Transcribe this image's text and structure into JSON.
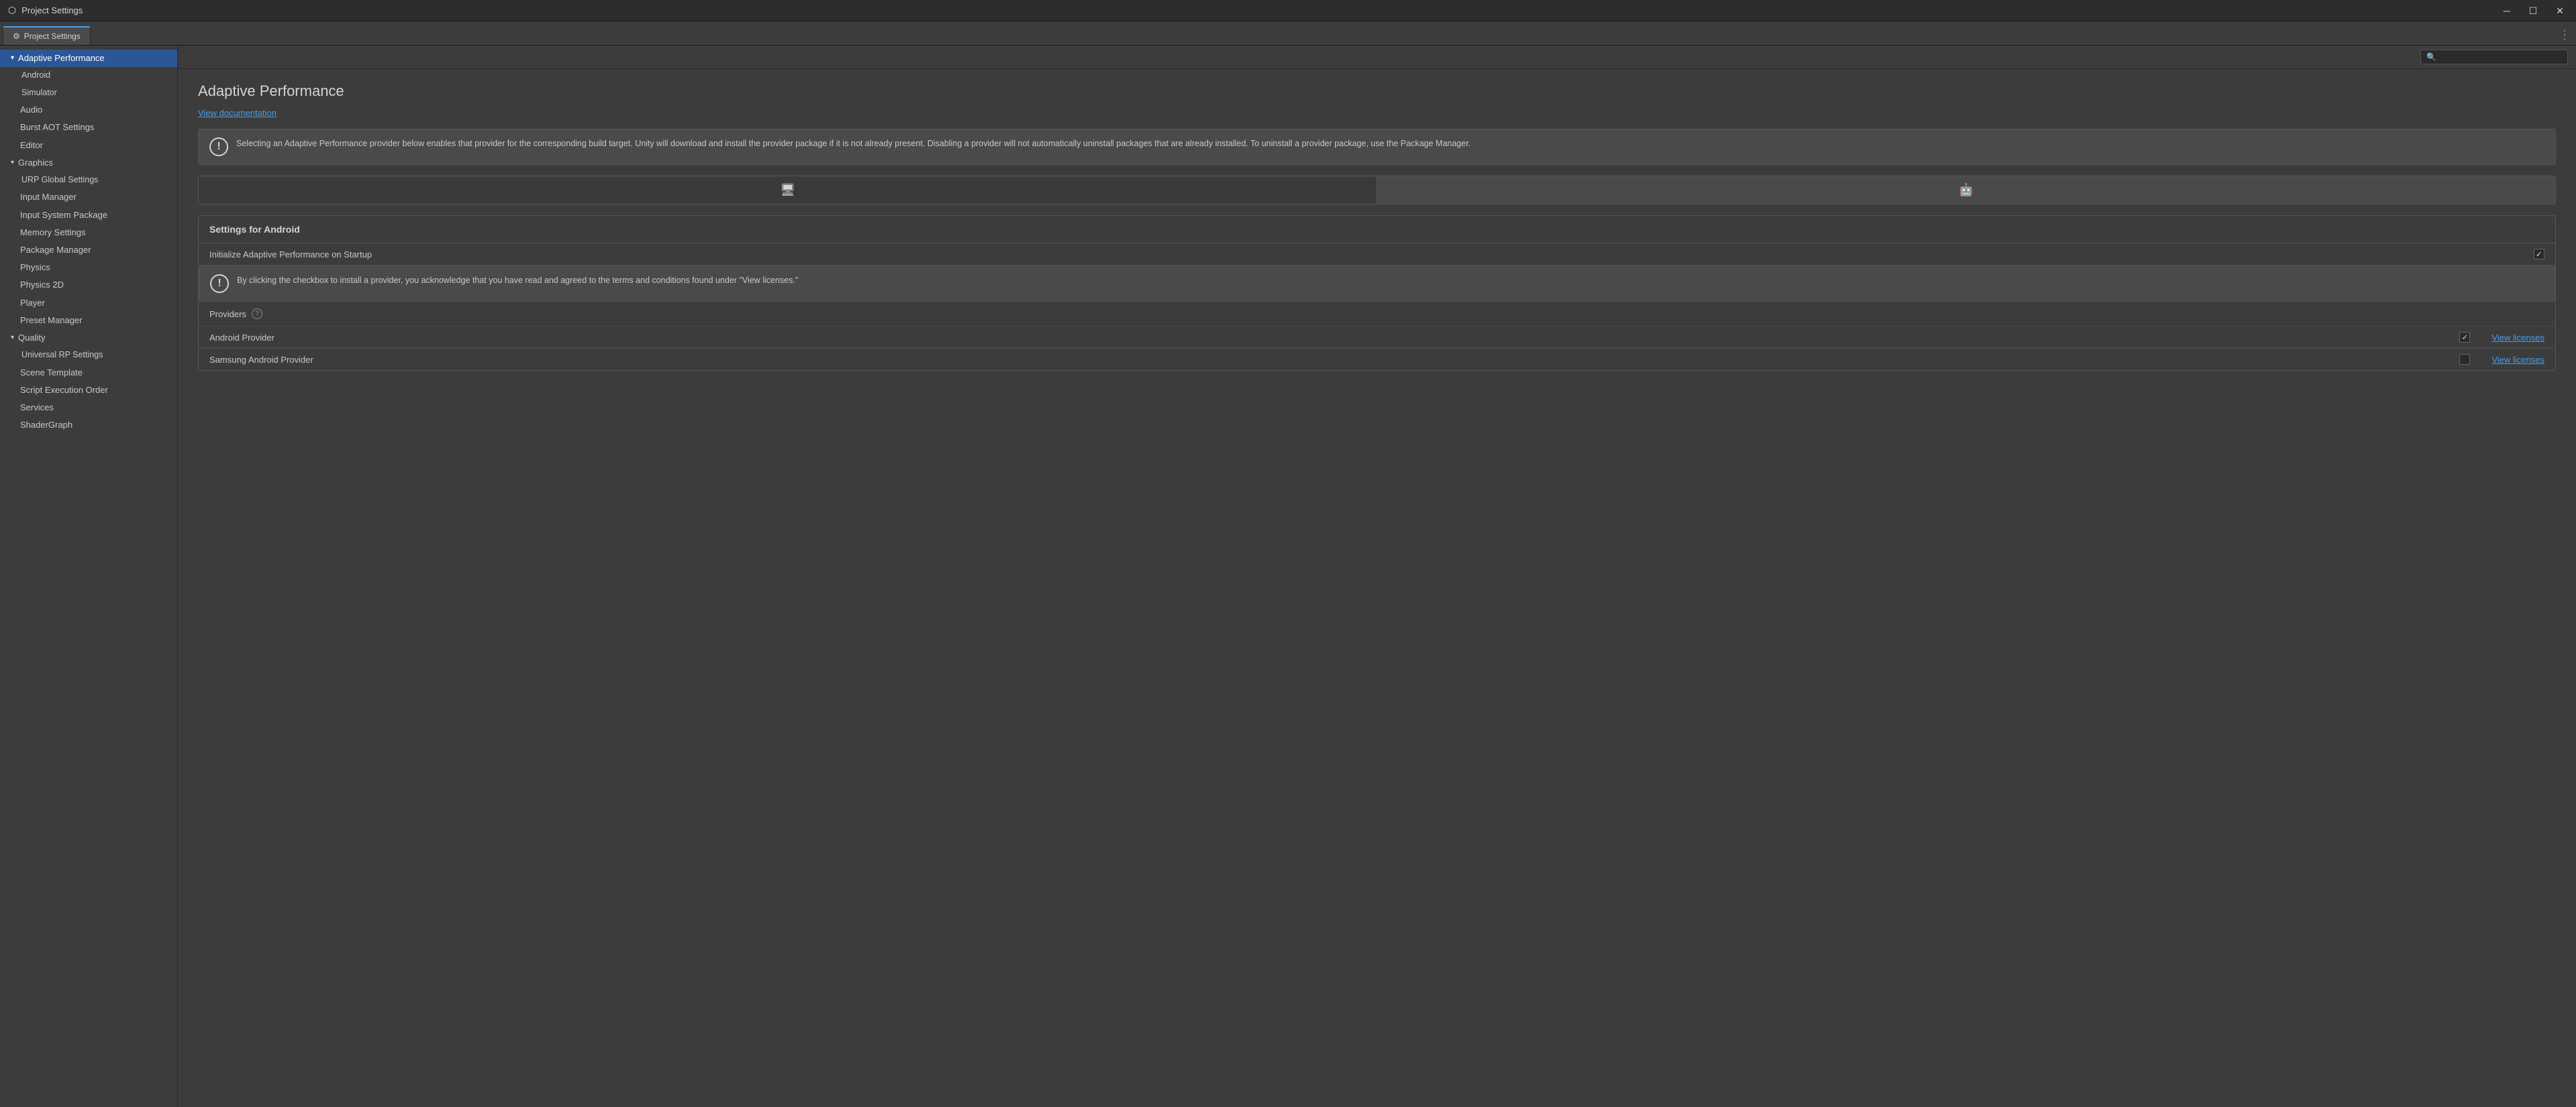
{
  "titleBar": {
    "icon": "⬡",
    "title": "Project Settings",
    "minBtn": "─",
    "maxBtn": "☐",
    "closeBtn": "✕"
  },
  "tab": {
    "icon": "⚙",
    "label": "Project Settings"
  },
  "search": {
    "placeholder": "",
    "icon": "🔍"
  },
  "sidebar": {
    "items": [
      {
        "id": "adaptive-performance",
        "label": "Adaptive Performance",
        "level": 0,
        "arrow": "down",
        "active": true
      },
      {
        "id": "android",
        "label": "Android",
        "level": 1,
        "arrow": ""
      },
      {
        "id": "simulator",
        "label": "Simulator",
        "level": 1,
        "arrow": ""
      },
      {
        "id": "audio",
        "label": "Audio",
        "level": 0,
        "arrow": ""
      },
      {
        "id": "burst-aot",
        "label": "Burst AOT Settings",
        "level": 0,
        "arrow": ""
      },
      {
        "id": "editor",
        "label": "Editor",
        "level": 0,
        "arrow": ""
      },
      {
        "id": "graphics",
        "label": "Graphics",
        "level": 0,
        "arrow": "down"
      },
      {
        "id": "urp-global",
        "label": "URP Global Settings",
        "level": 1,
        "arrow": ""
      },
      {
        "id": "input-manager",
        "label": "Input Manager",
        "level": 0,
        "arrow": ""
      },
      {
        "id": "input-system",
        "label": "Input System Package",
        "level": 0,
        "arrow": ""
      },
      {
        "id": "memory-settings",
        "label": "Memory Settings",
        "level": 0,
        "arrow": ""
      },
      {
        "id": "package-manager",
        "label": "Package Manager",
        "level": 0,
        "arrow": ""
      },
      {
        "id": "physics",
        "label": "Physics",
        "level": 0,
        "arrow": ""
      },
      {
        "id": "physics-2d",
        "label": "Physics 2D",
        "level": 0,
        "arrow": ""
      },
      {
        "id": "player",
        "label": "Player",
        "level": 0,
        "arrow": ""
      },
      {
        "id": "preset-manager",
        "label": "Preset Manager",
        "level": 0,
        "arrow": ""
      },
      {
        "id": "quality",
        "label": "Quality",
        "level": 0,
        "arrow": "down"
      },
      {
        "id": "universal-rp",
        "label": "Universal RP Settings",
        "level": 1,
        "arrow": ""
      },
      {
        "id": "scene-template",
        "label": "Scene Template",
        "level": 0,
        "arrow": ""
      },
      {
        "id": "script-execution",
        "label": "Script Execution Order",
        "level": 0,
        "arrow": ""
      },
      {
        "id": "services",
        "label": "Services",
        "level": 0,
        "arrow": ""
      },
      {
        "id": "shadergraph",
        "label": "ShaderGraph",
        "level": 0,
        "arrow": ""
      }
    ]
  },
  "mainContent": {
    "pageTitle": "Adaptive Performance",
    "viewDocsLabel": "View documentation",
    "infoMessage": "Selecting an Adaptive Performance provider below enables that provider for the corresponding build target. Unity will download and install the provider package if it is not already present. Disabling a provider will not automatically uninstall packages that are already installed. To uninstall a provider package, use the Package Manager.",
    "platformTabs": [
      {
        "id": "desktop",
        "icon": "🖥",
        "active": false
      },
      {
        "id": "android",
        "icon": "🤖",
        "active": true
      }
    ],
    "androidSettings": {
      "sectionTitle": "Settings for Android",
      "initLabel": "Initialize Adaptive Performance on Startup",
      "initChecked": true,
      "warningMessage": "By clicking the checkbox to install a provider, you acknowledge that you have read and agreed to the terms and conditions found under \"View licenses.\"",
      "providersLabel": "Providers",
      "providers": [
        {
          "name": "Android Provider",
          "checked": true,
          "viewLicensesLabel": "View licenses"
        },
        {
          "name": "Samsung Android Provider",
          "checked": false,
          "viewLicensesLabel": "View licenses"
        }
      ]
    }
  }
}
